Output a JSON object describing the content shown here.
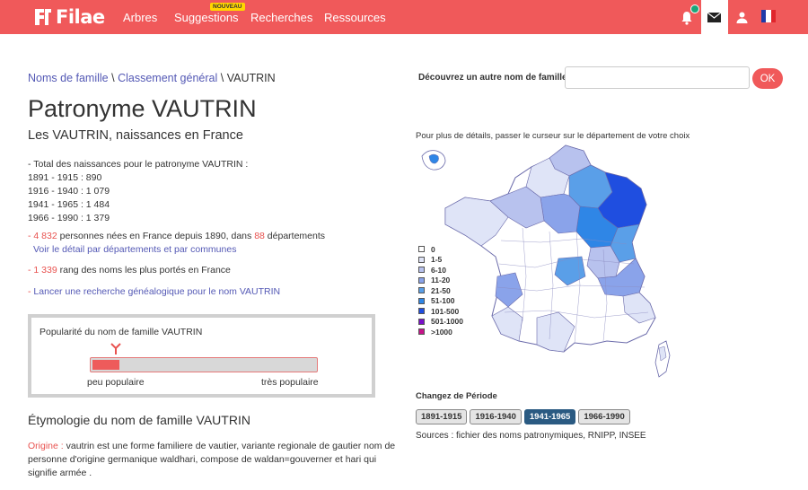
{
  "brand": {
    "name": "Filae",
    "color": "#f0595a"
  },
  "nav": {
    "items": [
      {
        "label": "Arbres"
      },
      {
        "label": "Suggestions"
      },
      {
        "label": "Recherches"
      },
      {
        "label": "Ressources"
      }
    ],
    "badge": "NOUVEAU"
  },
  "breadcrumb": {
    "part1": "Noms de famille",
    "part2": "Classement général",
    "current": "VAUTRIN",
    "sep": "\\"
  },
  "title": "Patronyme VAUTRIN",
  "subtitle": "Les VAUTRIN, naissances en France",
  "stats": {
    "header": "- Total des naissances pour le patronyme VAUTRIN :",
    "rows": [
      "1891 - 1915 : 890",
      "1916 - 1940 : 1 079",
      "1941 - 1965 : 1 484",
      "1966 - 1990 : 1 379"
    ]
  },
  "births": {
    "dash": "- ",
    "count": "4 832",
    "text1": " personnes nées en France depuis 1890, dans ",
    "depts": "88",
    "text2": " départements",
    "detail_link": "Voir le détail par départements et par communes"
  },
  "rank": {
    "dash": "- ",
    "value": "1 339",
    "text": " rang des noms les plus portés en France"
  },
  "search_link": {
    "dash": "- ",
    "label": "Lancer une recherche généalogique pour le nom VAUTRIN"
  },
  "popularity": {
    "title": "Popularité du nom de famille VAUTRIN",
    "low": "peu populaire",
    "high": "très populaire",
    "level": 0.12
  },
  "etymology": {
    "title": "Étymologie du nom de famille VAUTRIN",
    "label": "Origine :",
    "text": " vautrin est une forme familiere de vautier, variante regionale de gautier nom de personne d'origine germanique waldhari, compose de waldan=gouverner et hari qui signifie armée ."
  },
  "discover": {
    "label": "Découvrez un autre nom de famille",
    "value": "",
    "button": "OK"
  },
  "map": {
    "hint": "Pour plus de détails, passer le curseur sur le département de votre choix"
  },
  "legend": [
    {
      "label": "0",
      "color": "#ffffff"
    },
    {
      "label": "1-5",
      "color": "#dfe4f7"
    },
    {
      "label": "6-10",
      "color": "#b8c2ee"
    },
    {
      "label": "11-20",
      "color": "#8aa3ea"
    },
    {
      "label": "21-50",
      "color": "#5a9fe8"
    },
    {
      "label": "51-100",
      "color": "#2f86e6"
    },
    {
      "label": "101-500",
      "color": "#1f4ee0"
    },
    {
      "label": "501-1000",
      "color": "#7a10c9"
    },
    {
      "label": ">1000",
      "color": "#c7138a"
    }
  ],
  "periods": {
    "title": "Changez de Période",
    "items": [
      {
        "label": "1891-1915",
        "active": false
      },
      {
        "label": "1916-1940",
        "active": false
      },
      {
        "label": "1941-1965",
        "active": true
      },
      {
        "label": "1966-1990",
        "active": false
      }
    ]
  },
  "sources": "Sources : fichier des noms patronymiques, RNIPP, INSEE"
}
